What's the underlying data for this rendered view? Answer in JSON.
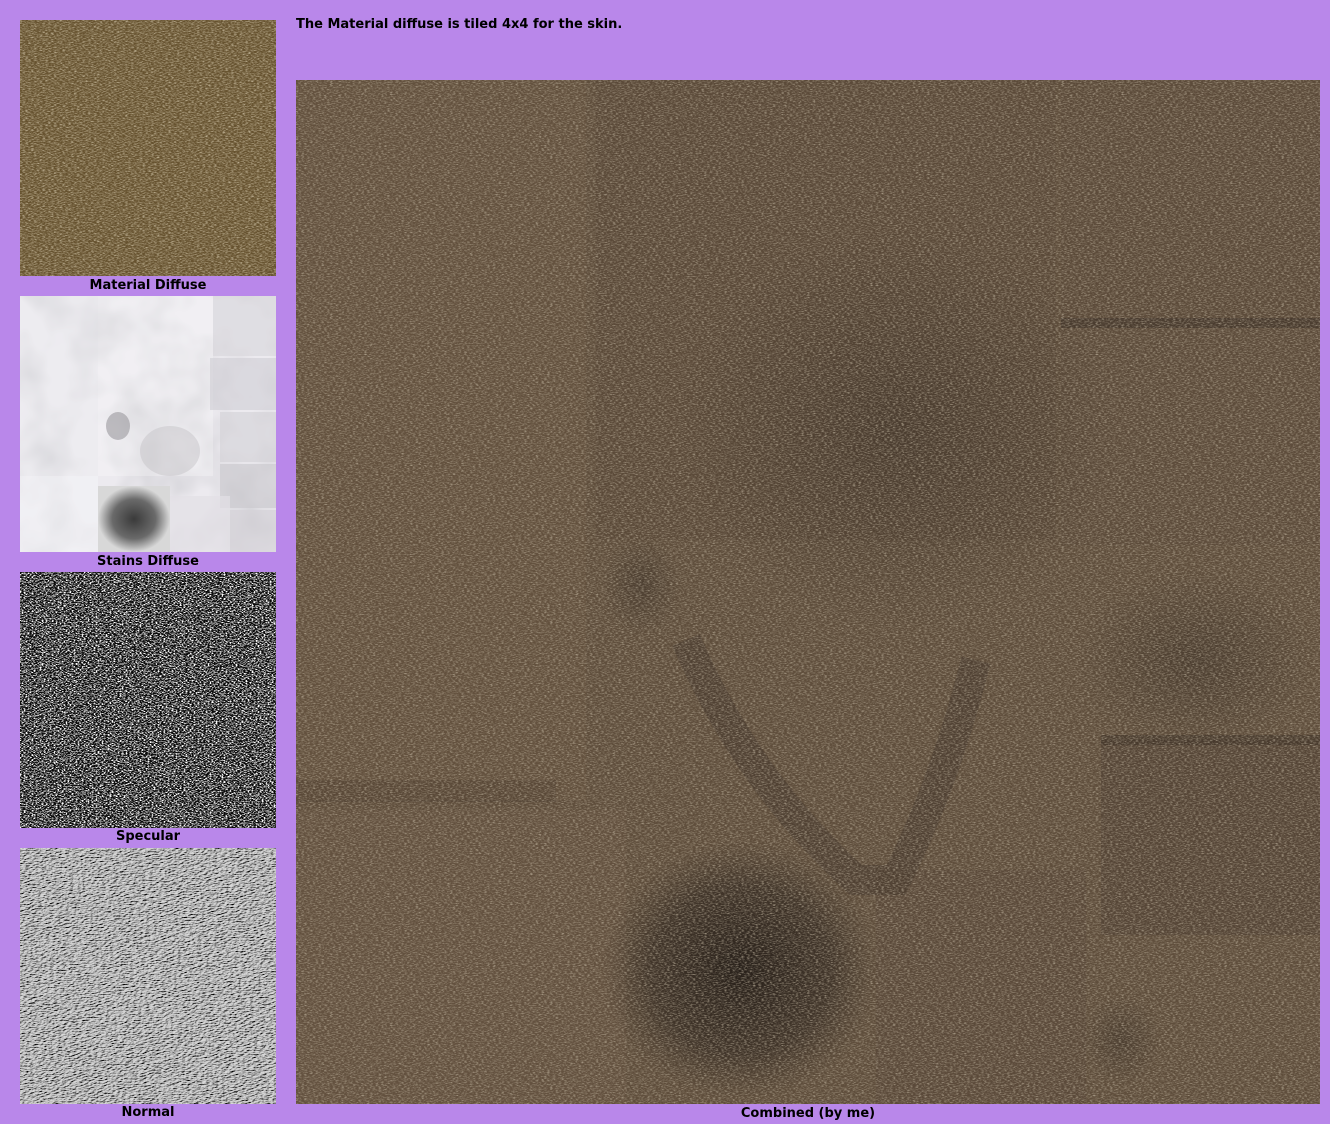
{
  "note": "The Material diffuse is tiled 4x4 for the skin.",
  "textures": [
    {
      "label": "Material Diffuse",
      "icon": "brown-fabric-texture",
      "base_color": "#6a5637"
    },
    {
      "label": "Stains Diffuse",
      "icon": "white-stains-map",
      "base_color": "#e8e6ea"
    },
    {
      "label": "Specular",
      "icon": "black-white-noise-map",
      "base_color": "#1a1a1a"
    },
    {
      "label": "Normal",
      "icon": "grey-emboss-normal-map",
      "base_color": "#bdbdbd"
    }
  ],
  "combined": {
    "label": "Combined (by me)",
    "icon": "combined-stained-fabric-texture",
    "base_color": "#5e4c3a"
  },
  "colors": {
    "background": "#b987ea"
  }
}
